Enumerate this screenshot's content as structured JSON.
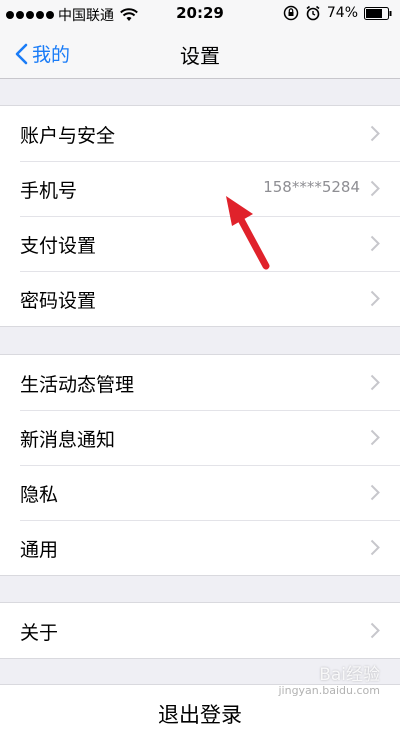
{
  "status_bar": {
    "carrier": "中国联通",
    "time": "20:29",
    "battery": "74%"
  },
  "nav": {
    "back_label": "我的",
    "title": "设置"
  },
  "groups": [
    {
      "items": [
        {
          "label": "账户与安全",
          "value": ""
        },
        {
          "label": "手机号",
          "value": "158****5284"
        },
        {
          "label": "支付设置",
          "value": ""
        },
        {
          "label": "密码设置",
          "value": ""
        }
      ]
    },
    {
      "items": [
        {
          "label": "生活动态管理",
          "value": ""
        },
        {
          "label": "新消息通知",
          "value": ""
        },
        {
          "label": "隐私",
          "value": ""
        },
        {
          "label": "通用",
          "value": ""
        }
      ]
    },
    {
      "items": [
        {
          "label": "关于",
          "value": ""
        }
      ]
    }
  ],
  "logout_label": "退出登录",
  "watermark": {
    "text": "Bai经验",
    "url": "jingyan.baidu.com"
  },
  "colors": {
    "accent": "#1a7cf7",
    "annotation_arrow": "#e0222b",
    "background": "#efeff4"
  }
}
